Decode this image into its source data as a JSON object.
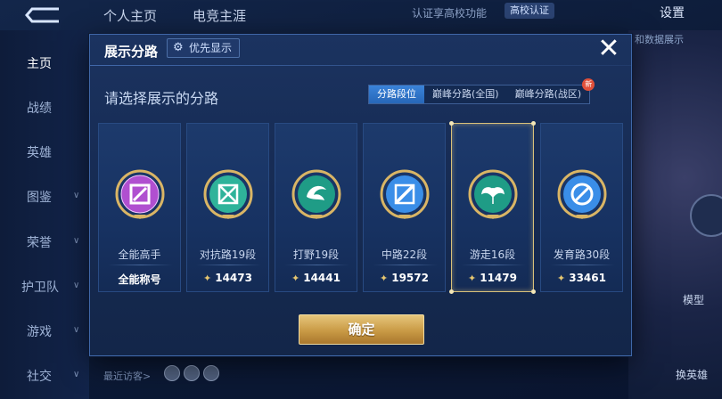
{
  "background": {
    "tabs": [
      "个人主页",
      "电竞主涯"
    ],
    "top_right": {
      "cert_hint": "认证享高校功能",
      "cert_badge": "高校认证",
      "settings": "设置"
    },
    "side_items": [
      "主页",
      "战绩",
      "英雄",
      "图鉴",
      "荣誉",
      "护卫队",
      "游戏",
      "社交"
    ],
    "right_text": "和数据展示",
    "right_labels": {
      "label1": "模型",
      "label2": "换英雄"
    },
    "visitor_label": "最近访客>"
  },
  "modal": {
    "title": "展示分路",
    "priority_label": "优先显示",
    "close": "✕",
    "subtitle": "请选择展示的分路",
    "segments": [
      {
        "label": "分路段位",
        "active": true
      },
      {
        "label": "巅峰分路(全国)",
        "active": false
      },
      {
        "label": "巅峰分路(战区)",
        "active": false,
        "badge": "新"
      }
    ],
    "cards": [
      {
        "name": "全能高手",
        "score": "全能称号",
        "has_icon": false,
        "icon": "allround-emblem-icon",
        "color": "#b04fd0"
      },
      {
        "name": "对抗路19段",
        "score": "14473",
        "has_icon": true,
        "icon": "clash-lane-emblem-icon",
        "color": "#2fb39a"
      },
      {
        "name": "打野19段",
        "score": "14441",
        "has_icon": true,
        "icon": "jungle-emblem-icon",
        "color": "#1f9c86"
      },
      {
        "name": "中路22段",
        "score": "19572",
        "has_icon": true,
        "icon": "mid-lane-emblem-icon",
        "color": "#3a8ee8"
      },
      {
        "name": "游走16段",
        "score": "11479",
        "has_icon": true,
        "icon": "roam-emblem-icon",
        "color": "#1f9c86",
        "selected": true
      },
      {
        "name": "发育路30段",
        "score": "33461",
        "has_icon": true,
        "icon": "farm-lane-emblem-icon",
        "color": "#3a8ee8"
      }
    ],
    "confirm": "确定"
  }
}
